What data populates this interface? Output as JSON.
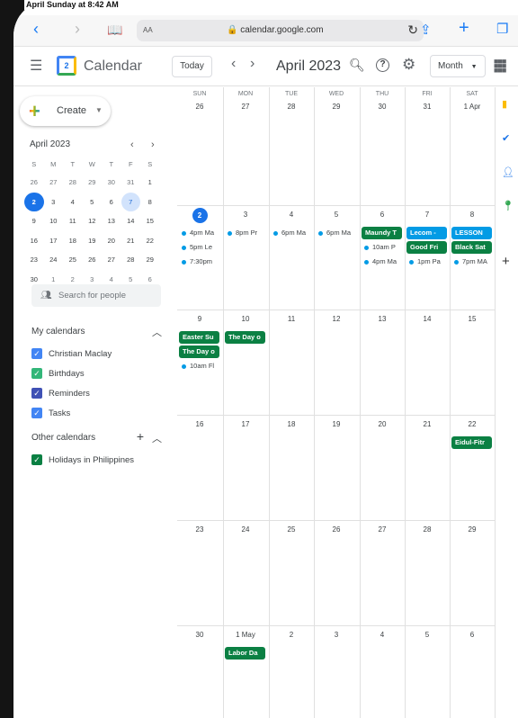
{
  "status_bar": {
    "time": "April Sunday at 8:42 AM"
  },
  "browser": {
    "url": "calendar.google.com",
    "text_size": "AA"
  },
  "header": {
    "app_title": "Calendar",
    "logo_day": "2",
    "today_label": "Today",
    "current_period": "April 2023",
    "view_label": "Month"
  },
  "sidebar": {
    "create_label": "Create",
    "mini_calendar": {
      "title": "April 2023",
      "day_names": [
        "S",
        "M",
        "T",
        "W",
        "T",
        "F",
        "S"
      ],
      "weeks": [
        [
          "26",
          "27",
          "28",
          "29",
          "30",
          "31",
          "1"
        ],
        [
          "2",
          "3",
          "4",
          "5",
          "6",
          "7",
          "8"
        ],
        [
          "9",
          "10",
          "11",
          "12",
          "13",
          "14",
          "15"
        ],
        [
          "16",
          "17",
          "18",
          "19",
          "20",
          "21",
          "22"
        ],
        [
          "23",
          "24",
          "25",
          "26",
          "27",
          "28",
          "29"
        ],
        [
          "30",
          "1",
          "2",
          "3",
          "4",
          "5",
          "6"
        ]
      ],
      "selected": "2",
      "highlighted": "7"
    },
    "search_people_placeholder": "Search for people",
    "my_calendars_label": "My calendars",
    "my_calendars": [
      {
        "name": "Christian Maclay",
        "color": "#4285f4"
      },
      {
        "name": "Birthdays",
        "color": "#33b679"
      },
      {
        "name": "Reminders",
        "color": "#3f51b5"
      },
      {
        "name": "Tasks",
        "color": "#4285f4"
      }
    ],
    "other_calendars_label": "Other calendars",
    "other_calendars": [
      {
        "name": "Holidays in Philippines",
        "color": "#0b8043"
      }
    ]
  },
  "grid": {
    "day_names": [
      "SUN",
      "MON",
      "TUE",
      "WED",
      "THU",
      "FRI",
      "SAT"
    ],
    "weeks": [
      [
        {
          "d": "26"
        },
        {
          "d": "27"
        },
        {
          "d": "28"
        },
        {
          "d": "29"
        },
        {
          "d": "30"
        },
        {
          "d": "31"
        },
        {
          "d": "1 Apr"
        }
      ],
      [
        {
          "d": "2",
          "today": true,
          "events": [
            {
              "t": "4pm Ma"
            },
            {
              "t": "5pm Le"
            },
            {
              "t": "7:30pm"
            }
          ]
        },
        {
          "d": "3",
          "events": [
            {
              "t": "8pm Pr"
            }
          ]
        },
        {
          "d": "4",
          "events": [
            {
              "t": "6pm Ma"
            }
          ]
        },
        {
          "d": "5",
          "events": [
            {
              "t": "6pm Ma"
            }
          ]
        },
        {
          "d": "6",
          "events": [
            {
              "t": "Maundy T",
              "c": "#0b8043"
            },
            {
              "t": "10am P"
            },
            {
              "t": "4pm Ma"
            }
          ]
        },
        {
          "d": "7",
          "events": [
            {
              "t": "Lecom - ",
              "c": "#039be5"
            },
            {
              "t": "Good Fri",
              "c": "#0b8043"
            },
            {
              "t": "1pm Pa"
            }
          ]
        },
        {
          "d": "8",
          "events": [
            {
              "t": "LESSON",
              "c": "#039be5"
            },
            {
              "t": "Black Sat",
              "c": "#0b8043"
            },
            {
              "t": "7pm MA"
            }
          ]
        }
      ],
      [
        {
          "d": "9",
          "events": [
            {
              "t": "Easter Su",
              "c": "#0b8043"
            },
            {
              "t": "The Day o",
              "c": "#0b8043"
            },
            {
              "t": "10am Fl"
            }
          ]
        },
        {
          "d": "10",
          "events": [
            {
              "t": "The Day o",
              "c": "#0b8043"
            }
          ]
        },
        {
          "d": "11"
        },
        {
          "d": "12"
        },
        {
          "d": "13"
        },
        {
          "d": "14"
        },
        {
          "d": "15"
        }
      ],
      [
        {
          "d": "16"
        },
        {
          "d": "17"
        },
        {
          "d": "18"
        },
        {
          "d": "19"
        },
        {
          "d": "20"
        },
        {
          "d": "21"
        },
        {
          "d": "22",
          "events": [
            {
              "t": "Eidul-Fitr",
              "c": "#0b8043"
            }
          ]
        }
      ],
      [
        {
          "d": "23"
        },
        {
          "d": "24"
        },
        {
          "d": "25"
        },
        {
          "d": "26"
        },
        {
          "d": "27"
        },
        {
          "d": "28"
        },
        {
          "d": "29"
        }
      ],
      [
        {
          "d": "30"
        },
        {
          "d": "1 May",
          "events": [
            {
              "t": "Labor Da",
              "c": "#0b8043"
            }
          ]
        },
        {
          "d": "2"
        },
        {
          "d": "3"
        },
        {
          "d": "4"
        },
        {
          "d": "5"
        },
        {
          "d": "6"
        }
      ]
    ]
  }
}
